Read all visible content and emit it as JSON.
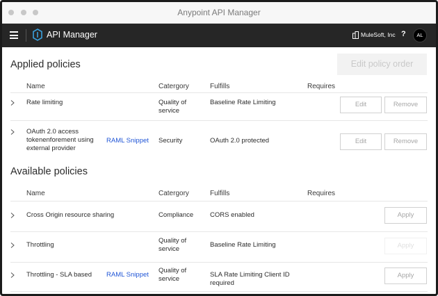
{
  "window": {
    "title": "Anypoint API Manager"
  },
  "nav": {
    "app_name": "API Manager",
    "org_name": "MuleSoft, Inc",
    "help": "?",
    "avatar_initials": "AL"
  },
  "applied": {
    "title": "Applied policies",
    "edit_order_label": "Edit policy order",
    "headers": {
      "name": "Name",
      "category": "Catergory",
      "fulfills": "Fulfills",
      "requires": "Requires"
    },
    "rows": [
      {
        "name": "Rate limiting",
        "category": "Quality of service",
        "fulfills": "Baseline Rate Limiting",
        "edit": "Edit",
        "remove": "Remove"
      },
      {
        "name": "OAuth 2.0 access tokenenforement using external provider",
        "snippet": "RAML Snippet",
        "category": "Security",
        "fulfills": "OAuth 2.0 protected",
        "edit": "Edit",
        "remove": "Remove"
      }
    ]
  },
  "available": {
    "title": "Available policies",
    "headers": {
      "name": "Name",
      "category": "Catergory",
      "fulfills": "Fulfills",
      "requires": "Requires"
    },
    "rows": [
      {
        "name": "Cross Origin resource sharing",
        "category": "Compliance",
        "fulfills": "CORS enabled",
        "apply": "Apply",
        "apply_enabled": true
      },
      {
        "name": "Throttling",
        "category": "Quality of service",
        "fulfills": "Baseline Rate Limiting",
        "apply": "Apply",
        "apply_enabled": false
      },
      {
        "name": "Throttling - SLA based",
        "snippet": "RAML Snippet",
        "category": "Quality of service",
        "fulfills": "SLA Rate Limiting Client ID required",
        "apply": "Apply",
        "apply_enabled": true
      }
    ]
  },
  "colors": {
    "navbar": "#262626",
    "link": "#1f55d6",
    "logo_accent": "#3aa0dc"
  },
  "icons": [
    "hamburger-icon",
    "api-manager-logo-icon",
    "organization-icon",
    "chevron-right-icon"
  ]
}
